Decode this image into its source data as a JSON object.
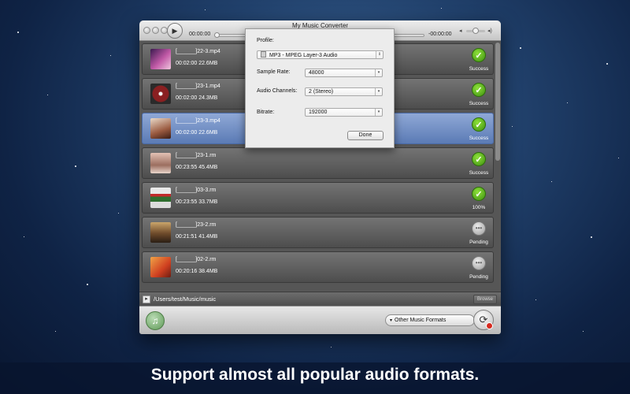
{
  "window": {
    "title": "My Music Converter",
    "time_elapsed": "00:00:00",
    "time_remaining": "-00:00:00"
  },
  "files": [
    {
      "name": "[______]22-3.mp4",
      "duration": "00:02:00",
      "size": "22.6MB",
      "status": "Success",
      "status_kind": "success",
      "thumb": "t1",
      "selected": false
    },
    {
      "name": "[______]23-1.mp4",
      "duration": "00:02:00",
      "size": "24.3MB",
      "status": "Success",
      "status_kind": "success",
      "thumb": "t2",
      "selected": false
    },
    {
      "name": "[______]23-3.mp4",
      "duration": "00:02:00",
      "size": "22.6MB",
      "status": "Success",
      "status_kind": "success",
      "thumb": "t3",
      "selected": true
    },
    {
      "name": "[______]23-1.rm",
      "duration": "00:23:55",
      "size": "45.4MB",
      "status": "Success",
      "status_kind": "success",
      "thumb": "t4",
      "selected": false
    },
    {
      "name": "[______]03-3.rm",
      "duration": "00:23:55",
      "size": "33.7MB",
      "status": "100%",
      "status_kind": "success",
      "thumb": "t5",
      "selected": false
    },
    {
      "name": "[______]23-2.rm",
      "duration": "00:21:51",
      "size": "41.4MB",
      "status": "Pending",
      "status_kind": "pending",
      "thumb": "t6",
      "selected": false
    },
    {
      "name": "[______]02-2.rm",
      "duration": "00:20:16",
      "size": "38.4MB",
      "status": "Pending",
      "status_kind": "pending",
      "thumb": "t7",
      "selected": false
    }
  ],
  "output": {
    "path": "/Users/test/Music/music",
    "browse_label": "Browse"
  },
  "format_select": {
    "value": "Other Music Formats"
  },
  "profile_sheet": {
    "profile_label": "Profile:",
    "profile_value": "MP3 - MPEG Layer-3 Audio",
    "sample_rate_label": "Sample Rate:",
    "sample_rate_value": "48000",
    "channels_label": "Audio Channels:",
    "channels_value": "2 (Stereo)",
    "bitrate_label": "Bitrate:",
    "bitrate_value": "192000",
    "done_label": "Done"
  },
  "caption": "Support almost all popular audio formats.",
  "icons": {
    "success": "checkmark-icon",
    "pending": "ellipsis-icon"
  },
  "colors": {
    "success_green": "#4caf1a",
    "selection_blue": "#6f8fc7"
  }
}
